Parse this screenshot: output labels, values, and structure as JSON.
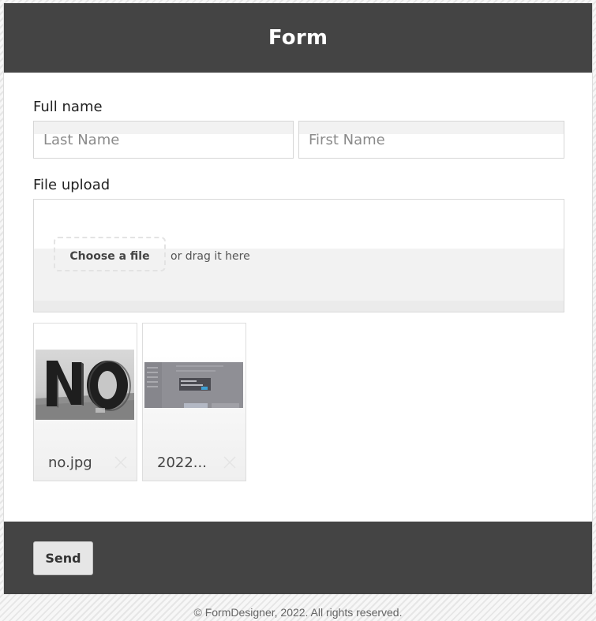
{
  "form": {
    "title": "Form"
  },
  "full_name": {
    "label": "Full name",
    "last_name_placeholder": "Last Name",
    "first_name_placeholder": "First Name",
    "last_name_value": "",
    "first_name_value": ""
  },
  "file_upload": {
    "label": "File upload",
    "choose_label": "Choose a file",
    "drag_text": "or drag it here",
    "files": [
      {
        "name": "no.jpg",
        "thumbnail": "photo-of-large-no-letters"
      },
      {
        "name": "2022...",
        "thumbnail": "screenshot-thumbnail"
      }
    ]
  },
  "footer": {
    "send_label": "Send"
  },
  "copyright": "© FormDesigner, 2022. All rights reserved.",
  "colors": {
    "header_bg": "#444444",
    "footer_bg": "#444444",
    "page_bg": "#ffffff",
    "send_button_bg": "#e6e6e6"
  },
  "icons": {
    "remove": "close-icon"
  }
}
